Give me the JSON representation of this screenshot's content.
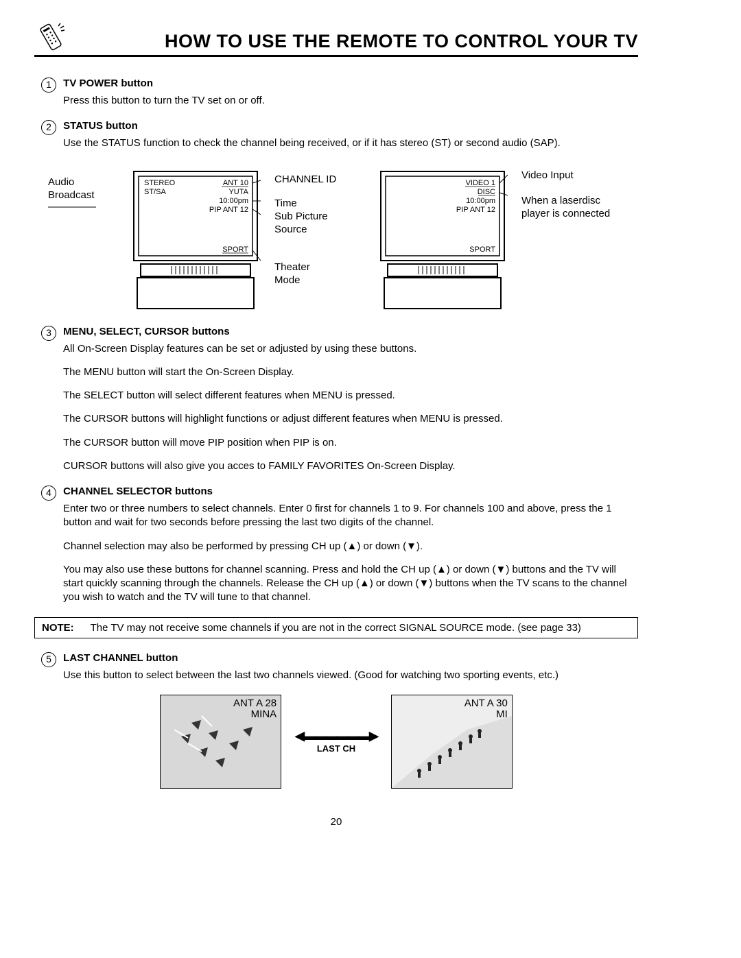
{
  "header": {
    "title": "HOW TO USE THE REMOTE TO CONTROL YOUR TV"
  },
  "items": {
    "i1": {
      "num": "1",
      "title": "TV POWER button",
      "desc": "Press this button to turn the TV set on or off."
    },
    "i2": {
      "num": "2",
      "title": "STATUS button",
      "desc": "Use the STATUS function to check the channel being received, or if it has stereo (ST) or second audio (SAP)."
    },
    "i3": {
      "num": "3",
      "title": "MENU, SELECT, CURSOR buttons",
      "p1": "All On-Screen Display features can be set or adjusted by using these buttons.",
      "p2": "The MENU button will start the On-Screen Display.",
      "p3": "The SELECT button will select different features when MENU is pressed.",
      "p4": "The CURSOR buttons will highlight functions or adjust different features when MENU is pressed.",
      "p5": "The CURSOR button will move PIP position when PIP is on.",
      "p6": "CURSOR buttons will also give you acces to FAMILY FAVORITES On-Screen Display."
    },
    "i4": {
      "num": "4",
      "title": "CHANNEL SELECTOR buttons",
      "p1": "Enter two or three numbers to select channels.  Enter  0  first for channels 1 to 9.  For channels 100 and above, press the  1 button and wait for two seconds before pressing the last two digits of the channel.",
      "p2": "Channel selection may also be performed by pressing CH up (▲) or down (▼).",
      "p3": "You may also use these buttons for channel scanning.  Press and hold the CH up (▲) or down (▼) buttons and the TV will start quickly scanning through the channels.  Release the CH up (▲) or down (▼) buttons when the TV scans to the channel you wish to watch and the TV will tune to that channel."
    },
    "i5": {
      "num": "5",
      "title": "LAST CHANNEL button",
      "desc": "Use this button to select between the last two channels viewed.  (Good for watching two sporting events, etc.)"
    }
  },
  "note": {
    "label": "NOTE:",
    "text": "The TV may not receive some channels if you are not in the correct SIGNAL SOURCE mode.  (see page 33)"
  },
  "diagram": {
    "left_labels": {
      "l1": "Audio",
      "l2": "Broadcast"
    },
    "tv1_screen": {
      "tl1": "STEREO",
      "tl2": "ST/SA",
      "tr1": "ANT 10",
      "tr2": "YUTA",
      "tr3": "10:00pm",
      "tr4": "PIP ANT 12",
      "br": "SPORT"
    },
    "mid_labels": {
      "m1": "CHANNEL ID",
      "m2": "Time",
      "m3": "Sub Picture",
      "m4": "Source",
      "m5": "Theater",
      "m6": "Mode"
    },
    "tv2_screen": {
      "tr1": "VIDEO 1",
      "tr2": "DISC",
      "tr3": "10:00pm",
      "tr4": "PIP ANT 12",
      "br": "SPORT"
    },
    "right_labels": {
      "r1": "Video Input",
      "r2": "When a laserdisc",
      "r3": "player is connected"
    }
  },
  "lastch": {
    "thumb1": {
      "line1": "ANT A 28",
      "line2": "MINA"
    },
    "arrow_label": "LAST CH",
    "thumb2": {
      "line1": "ANT A 30",
      "line2": "MI"
    }
  },
  "page_number": "20"
}
